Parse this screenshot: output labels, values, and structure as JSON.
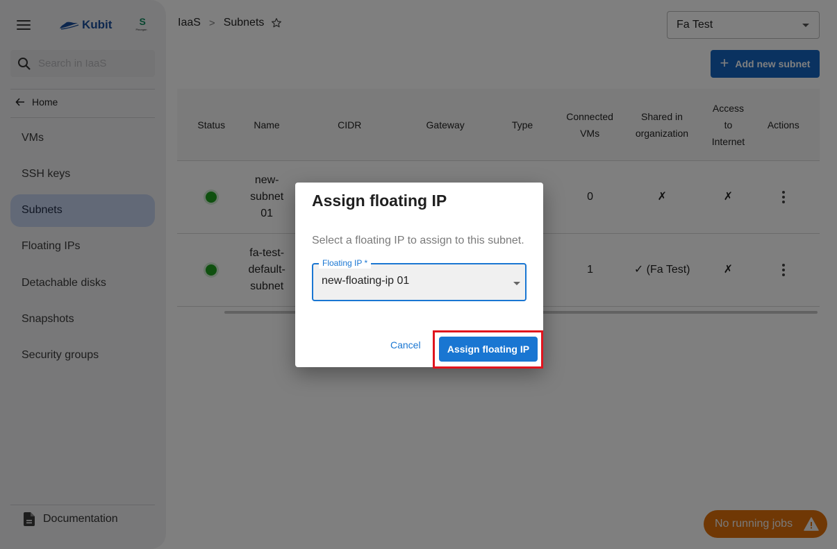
{
  "sidebar": {
    "brand": "Kubit",
    "partner_logo_letter": "S",
    "partner_logo_caption": "Pinorgan",
    "search_placeholder": "Search in IaaS",
    "home_label": "Home",
    "items": [
      {
        "label": "VMs",
        "active": false
      },
      {
        "label": "SSH keys",
        "active": false
      },
      {
        "label": "Subnets",
        "active": true
      },
      {
        "label": "Floating IPs",
        "active": false
      },
      {
        "label": "Detachable disks",
        "active": false
      },
      {
        "label": "Snapshots",
        "active": false
      },
      {
        "label": "Security groups",
        "active": false
      }
    ],
    "documentation_label": "Documentation"
  },
  "header": {
    "breadcrumb": [
      "IaaS",
      "Subnets"
    ],
    "breadcrumb_separator": ">",
    "org_select_value": "Fa Test",
    "add_button_label": "Add new subnet"
  },
  "table": {
    "columns": [
      "Status",
      "Name",
      "CIDR",
      "Gateway",
      "Type",
      "Connected VMs",
      "Shared in organization",
      "Access to Internet",
      "Actions"
    ],
    "rows": [
      {
        "status": "active",
        "name": "new-subnet 01",
        "cidr": "",
        "gateway": "",
        "connected_vms": "0",
        "shared": "✗",
        "access": "✗"
      },
      {
        "status": "active",
        "name": "fa-test-default-subnet",
        "cidr": "",
        "gateway": "",
        "connected_vms": "1",
        "shared": "✓ (Fa Test)",
        "access": "✗"
      }
    ]
  },
  "jobs": {
    "label": "No running jobs"
  },
  "dialog": {
    "title": "Assign floating IP",
    "description": "Select a floating IP to assign to this subnet.",
    "field_label": "Floating IP *",
    "field_value": "new-floating-ip 01",
    "cancel_label": "Cancel",
    "confirm_label": "Assign floating IP"
  },
  "colors": {
    "primary": "#1976d2",
    "brand": "#1b4f9c",
    "status_active": "#1fa01f",
    "jobs_pill": "#e0700a",
    "highlight": "#e0141e"
  }
}
